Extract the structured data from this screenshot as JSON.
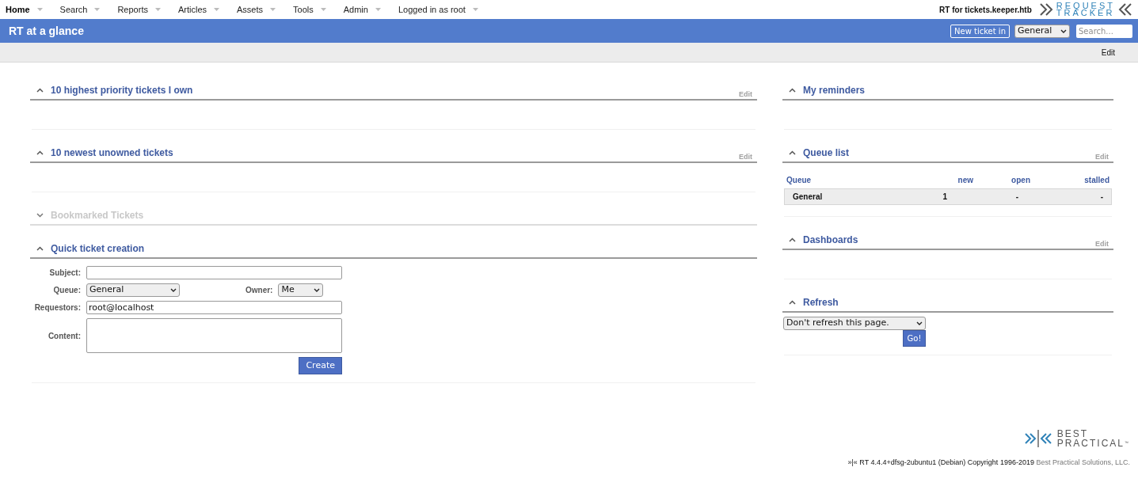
{
  "nav": [
    {
      "label": "Home",
      "selected": true
    },
    {
      "label": "Search",
      "selected": false
    },
    {
      "label": "Reports",
      "selected": false
    },
    {
      "label": "Articles",
      "selected": false
    },
    {
      "label": "Assets",
      "selected": false
    },
    {
      "label": "Tools",
      "selected": false
    },
    {
      "label": "Admin",
      "selected": false
    },
    {
      "label": "Logged in as root",
      "selected": false
    }
  ],
  "site_title": "RT for tickets.keeper.htb",
  "logo": {
    "line_1": "REQUEST",
    "line_2": "TRACKER"
  },
  "page_title": "RT at a glance",
  "header_controls": {
    "new_ticket_button": "New ticket in",
    "queue_select": "General",
    "search_placeholder": "Search..."
  },
  "subbar_edit": "Edit",
  "left_sections": [
    {
      "kind": "empty",
      "title": "10 highest priority tickets I own",
      "expanded": true,
      "edit": "Edit"
    },
    {
      "kind": "empty",
      "title": "10 newest unowned tickets",
      "expanded": true,
      "edit": "Edit"
    },
    {
      "kind": "empty",
      "title": "Bookmarked Tickets",
      "expanded": false
    },
    {
      "kind": "form",
      "title": "Quick ticket creation",
      "expanded": true,
      "form": {
        "subject_label": "Subject:",
        "queue_label": "Queue:",
        "queue_value": "General",
        "owner_label": "Owner:",
        "owner_value": "Me",
        "requestors_label": "Requestors:",
        "requestors_value": "root@localhost",
        "content_label": "Content:",
        "submit": "Create"
      }
    }
  ],
  "right_sections": [
    {
      "kind": "empty",
      "title": "My reminders",
      "expanded": true
    },
    {
      "kind": "queues",
      "title": "Queue list",
      "expanded": true,
      "edit": "Edit",
      "columns": [
        "Queue",
        "new",
        "open",
        "stalled"
      ],
      "rows": [
        [
          "General",
          "1",
          "-",
          "-"
        ]
      ]
    },
    {
      "kind": "empty",
      "title": "Dashboards",
      "expanded": true,
      "edit": "Edit"
    },
    {
      "kind": "refresh",
      "title": "Refresh",
      "expanded": true,
      "select": "Don't refresh this page.",
      "button": "Go!"
    }
  ],
  "footer": {
    "logo_line_1": "BEST",
    "logo_line_2": "PRACTICAL",
    "logo_mark": "™",
    "text": "»|« RT 4.4.4+dfsg-2ubuntu1 (Debian) Copyright 1996-2019",
    "link": "Best Practical Solutions, LLC."
  }
}
